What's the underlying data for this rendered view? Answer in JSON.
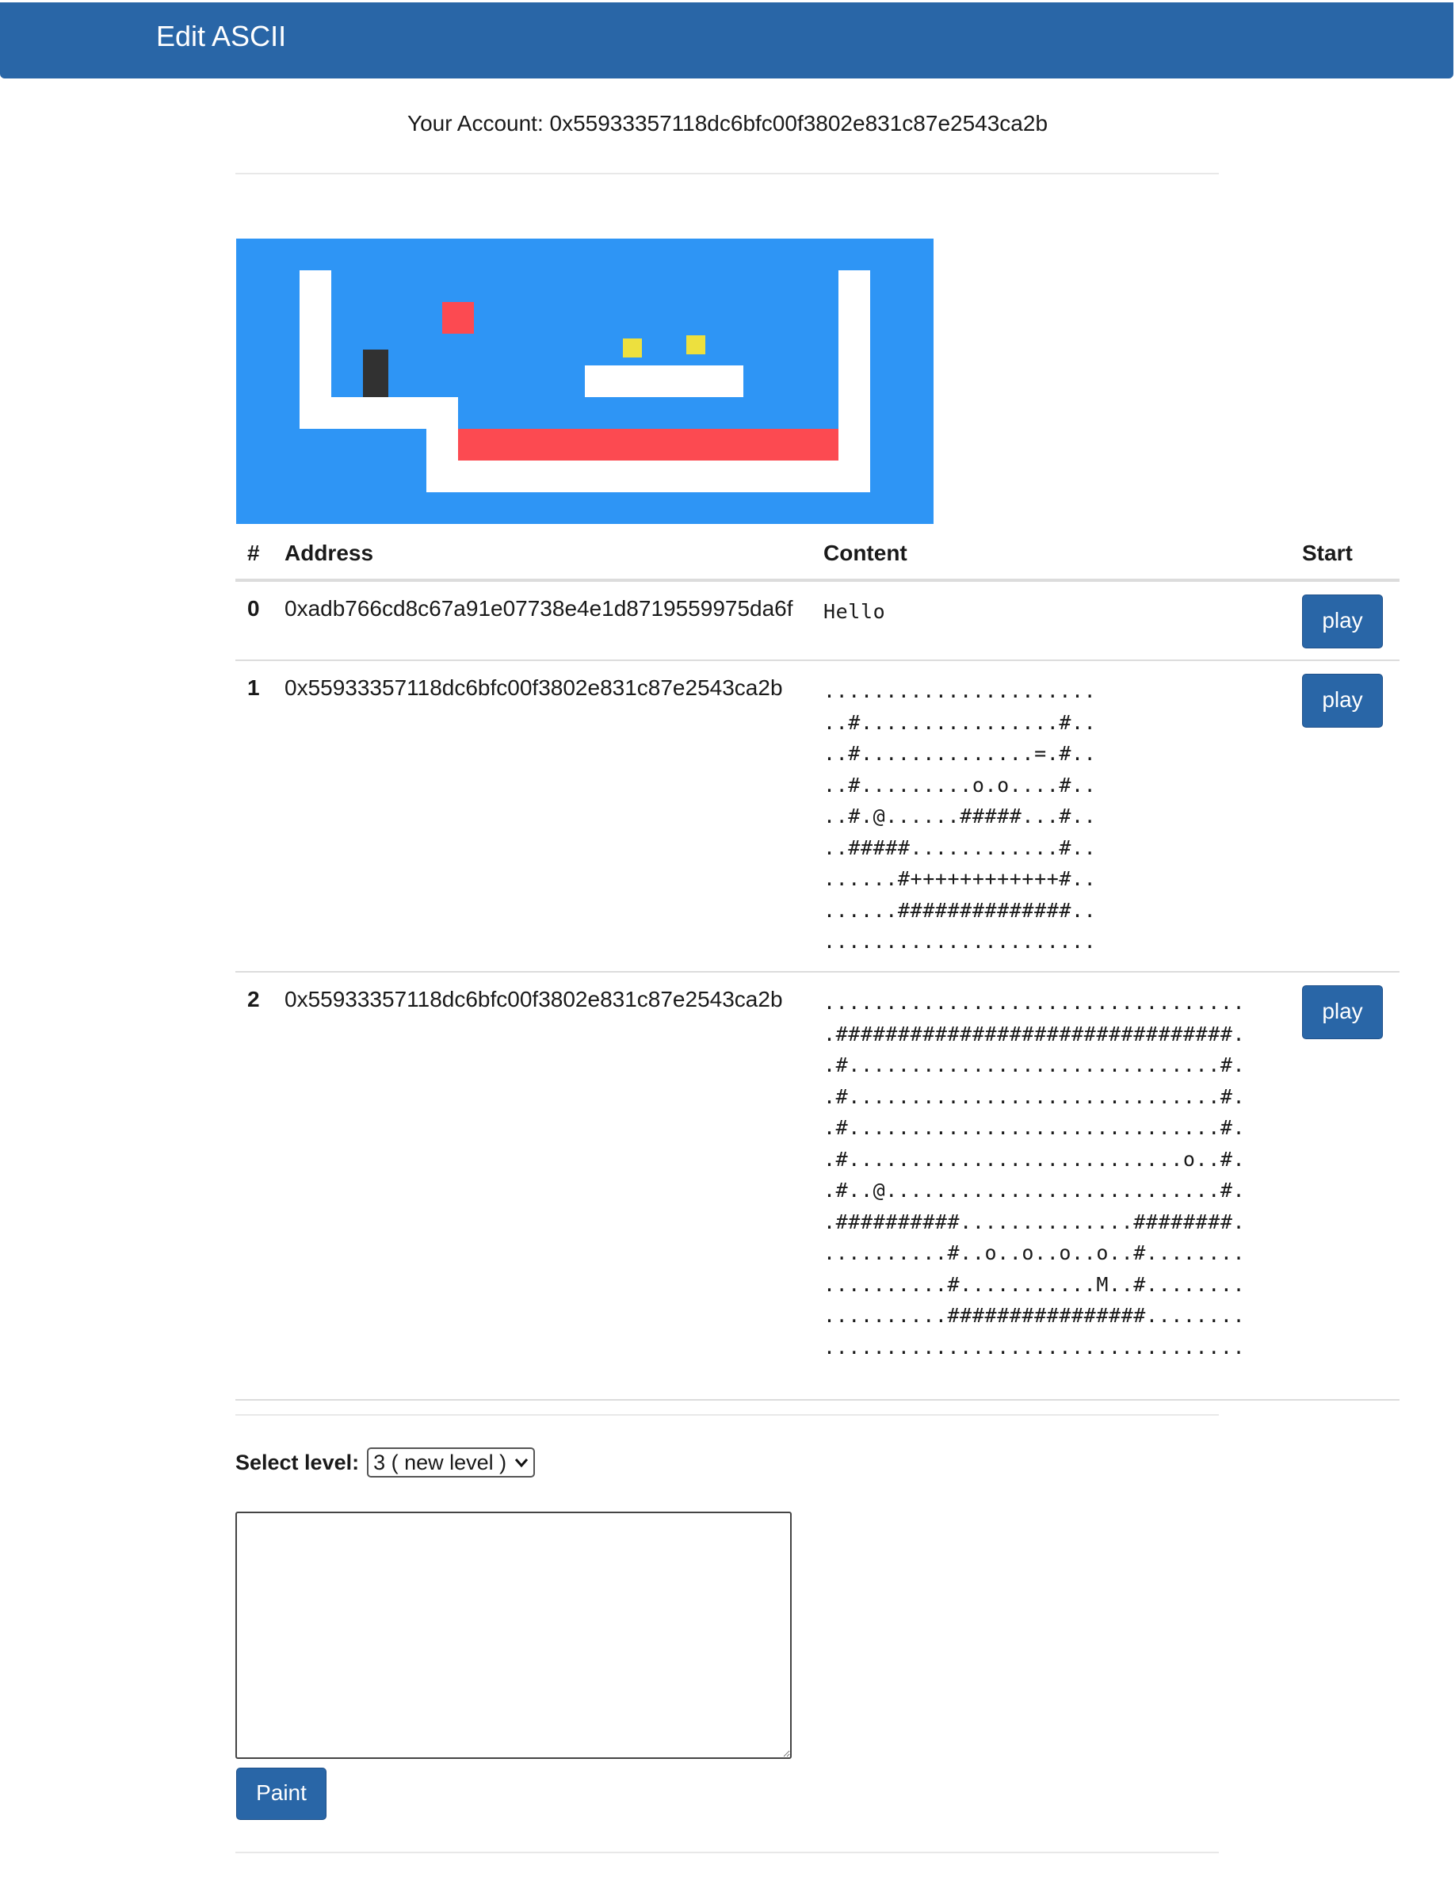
{
  "navbar": {
    "title": "Edit ASCII"
  },
  "account": {
    "text": "Your Account: 0x55933357118dc6bfc00f3802e831c87e2543ca2b"
  },
  "preview": {
    "colors": {
      "background": "#2e95f5",
      "wall": "#ffffff",
      "lava": "#fc4a51",
      "coin": "#ede03e",
      "player": "#313131"
    }
  },
  "table": {
    "headers": {
      "index": "#",
      "address": "Address",
      "content": "Content",
      "start": "Start"
    },
    "rows": [
      {
        "index": "0",
        "address": "0xadb766cd8c67a91e07738e4e1d8719559975da6f",
        "content": "Hello",
        "button": "play"
      },
      {
        "index": "1",
        "address": "0x55933357118dc6bfc00f3802e831c87e2543ca2b",
        "content": "......................\n..#................#..\n..#..............=.#..\n..#.........o.o....#..\n..#.@......#####...#..\n..#####............#..\n......#++++++++++++#..\n......##############..\n......................",
        "button": "play"
      },
      {
        "index": "2",
        "address": "0x55933357118dc6bfc00f3802e831c87e2543ca2b",
        "content": "..................................\n.################################.\n.#..............................#.\n.#..............................#.\n.#..............................#.\n.#...........................o..#.\n.#..@...........................#.\n.##########..............########.\n..........#..o..o..o..o..#........\n..........#...........M..#........\n..........################........\n..................................",
        "button": "play"
      }
    ]
  },
  "editor": {
    "select_label": "Select level:",
    "select_value": "3 ( new level )",
    "textarea_value": "",
    "paint_label": "Paint"
  }
}
